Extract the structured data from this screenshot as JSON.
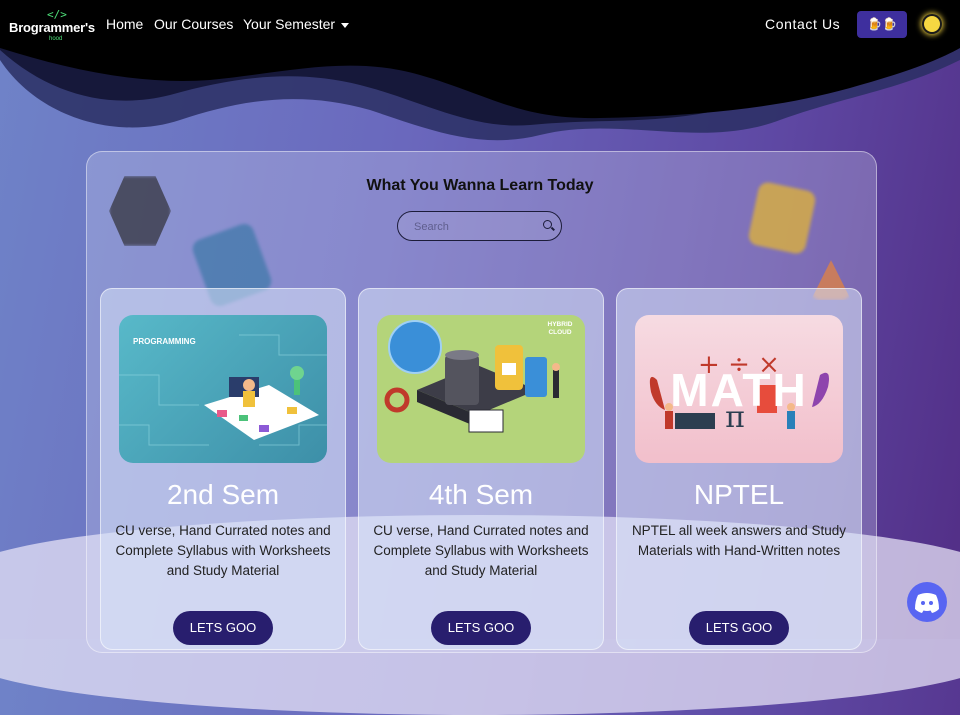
{
  "brand": {
    "code_glyph": "</>",
    "name": "Brogrammer's",
    "sub": "hood"
  },
  "nav": {
    "home": "Home",
    "courses": "Our Courses",
    "semester": "Your Semester",
    "contact": "Contact Us",
    "beer_button": "🍺🍺"
  },
  "panel": {
    "title": "What You Wanna Learn Today",
    "search_placeholder": "Search"
  },
  "cards": [
    {
      "title": "2nd Sem",
      "image_label": "PROGRAMMING",
      "description": "CU verse, Hand Currated notes and Complete Syllabus with Worksheets and Study Material",
      "button": "LETS GOO"
    },
    {
      "title": "4th Sem",
      "image_label": "HYBRID CLOUD",
      "description": "CU verse, Hand Currated notes and Complete Syllabus with Worksheets and Study Material",
      "button": "LETS GOO"
    },
    {
      "title": "NPTEL",
      "image_label": "MATH",
      "description": "NPTEL all week answers and Study Materials with Hand-Written notes",
      "button": "LETS GOO"
    }
  ],
  "colors": {
    "accent": "#281e6e",
    "brand_green": "#4ee07a",
    "discord": "#5865f2"
  }
}
